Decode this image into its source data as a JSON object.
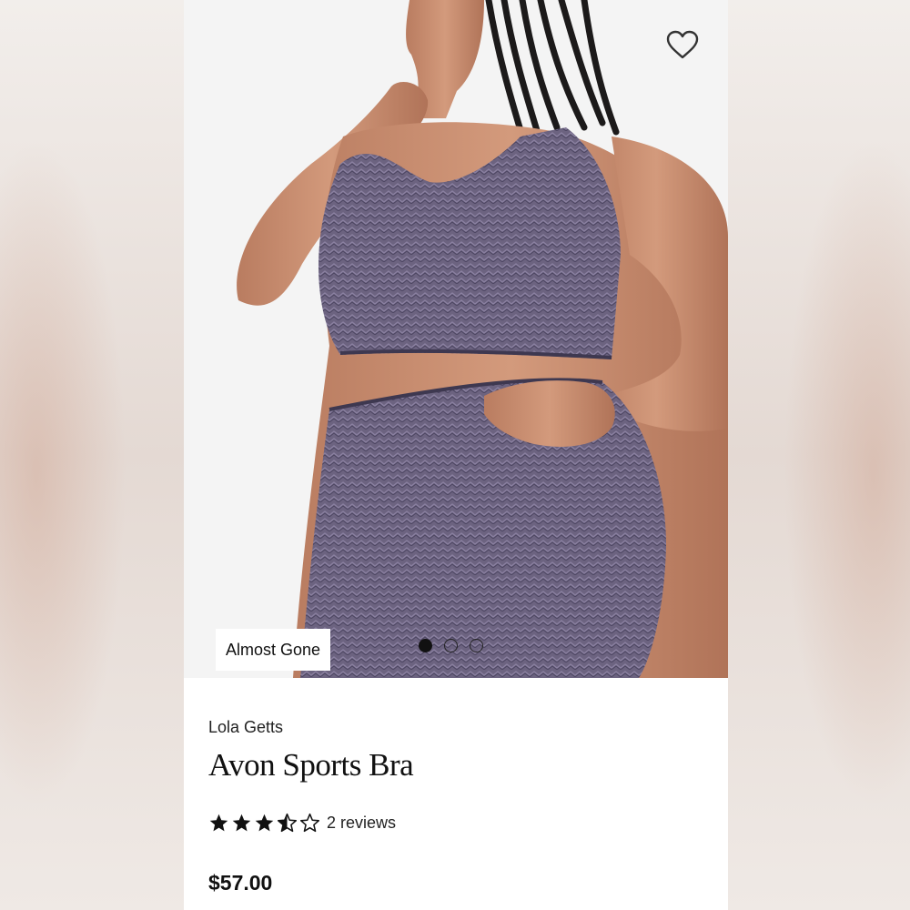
{
  "product": {
    "badge": "Almost Gone",
    "brand": "Lola Getts",
    "title": "Avon Sports Bra",
    "rating": 3.5,
    "rating_max": 5,
    "reviews_label": "2 reviews",
    "price": "$57.00"
  },
  "gallery": {
    "image_count": 3,
    "active_index": 0
  },
  "icons": {
    "favorite": "heart-outline-icon",
    "star_full": "star-filled-icon",
    "star_half": "star-half-icon",
    "star_empty": "star-outline-icon"
  },
  "colors": {
    "text": "#111111",
    "fabric": "#6e6480",
    "skin": "#c98f73",
    "badge_bg": "#ffffff"
  }
}
